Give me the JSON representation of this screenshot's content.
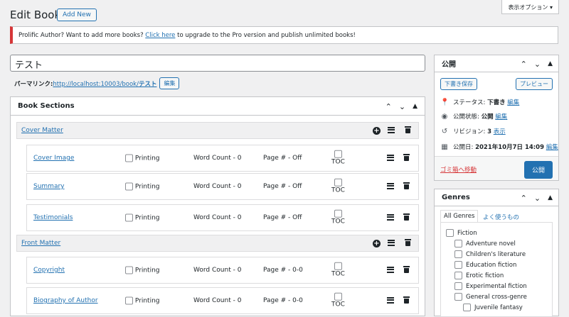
{
  "header": {
    "title": "Edit Book",
    "add_new": "Add New",
    "screen_options": "表示オプション ▾"
  },
  "notice": {
    "text_before": "Prolific Author? Want to add more books? ",
    "link": "Click here",
    "text_after": " to upgrade to the Pro version and publish unlimited books!",
    "accent": "#d63638"
  },
  "title_field": {
    "value": "テスト"
  },
  "permalink": {
    "label": "パーマリンク: ",
    "url_prefix": "http://localhost:10003/book/",
    "slug": "テスト",
    "edit": "編集"
  },
  "sections": {
    "title": "Book Sections",
    "groups": [
      {
        "name": "Cover Matter",
        "items": [
          {
            "name": "Cover Image",
            "printing": "Printing",
            "word_count": "Word Count - 0",
            "page": "Page # - Off",
            "toc": "TOC"
          },
          {
            "name": "Summary",
            "printing": "Printing",
            "word_count": "Word Count - 0",
            "page": "Page # - Off",
            "toc": "TOC"
          },
          {
            "name": "Testimonials",
            "printing": "Printing",
            "word_count": "Word Count - 0",
            "page": "Page # - Off",
            "toc": "TOC"
          }
        ]
      },
      {
        "name": "Front Matter",
        "items": [
          {
            "name": "Copyright",
            "printing": "Printing",
            "word_count": "Word Count - 0",
            "page": "Page # - 0-0",
            "toc": "TOC"
          },
          {
            "name": "Biography of Author",
            "printing": "Printing",
            "word_count": "Word Count - 0",
            "page": "Page # - 0-0",
            "toc": "TOC"
          }
        ]
      }
    ]
  },
  "publish": {
    "title": "公開",
    "save_draft": "下書き保存",
    "preview": "プレビュー",
    "status_label": "ステータス: ",
    "status_value": "下書き",
    "status_edit": "編集",
    "visibility_label": "公開状態: ",
    "visibility_value": "公開",
    "visibility_edit": "編集",
    "revisions_label": "リビジョン: ",
    "revisions_value": "3",
    "revisions_link": "表示",
    "date_label": "公開日: ",
    "date_value": "2021年10月7日 14:09",
    "date_edit": "編集",
    "trash": "ゴミ箱へ移動",
    "publish_button": "公開"
  },
  "genres": {
    "title": "Genres",
    "tab_all": "All Genres",
    "tab_popular": "よく使うもの",
    "items": [
      "Fiction",
      "Adventure novel",
      "Children's literature",
      "Education fiction",
      "Erotic fiction",
      "Experimental fiction",
      "General cross-genre",
      "Juvenile fantasy"
    ]
  },
  "colors": {
    "accent": "#2271b1",
    "danger": "#d63638"
  }
}
